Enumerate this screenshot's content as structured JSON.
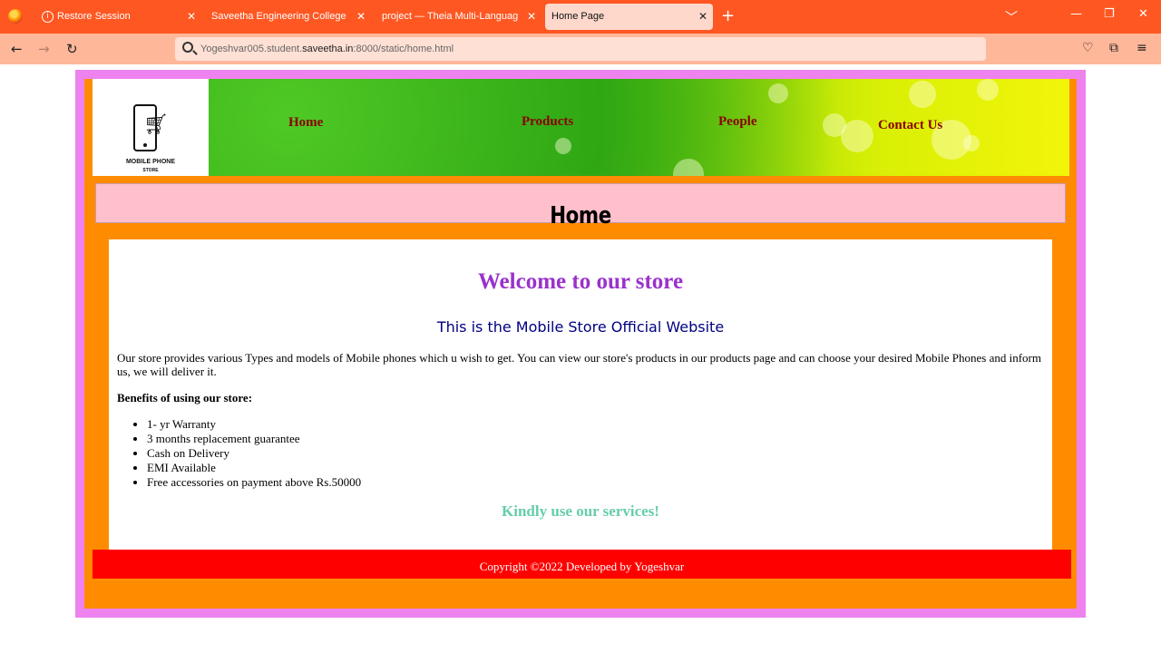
{
  "browser": {
    "tabs": [
      {
        "label": "Restore Session",
        "active": false
      },
      {
        "label": "Saveetha Engineering College",
        "active": false
      },
      {
        "label": "project — Theia Multi-Language Ex",
        "active": false
      },
      {
        "label": "Home Page",
        "active": true
      }
    ],
    "url_prefix": "Yogeshvar005.student.",
    "url_domain": "saveetha.in",
    "url_suffix": ":8000/static/home.html",
    "accent_color": "#ff5722"
  },
  "site": {
    "logo_line1": "MOBILE PHONE",
    "logo_line2": "STORE",
    "nav": [
      {
        "label": "Home"
      },
      {
        "label": "Products"
      },
      {
        "label": "People"
      },
      {
        "label": "Contact Us"
      }
    ],
    "page_title": "Home"
  },
  "content": {
    "welcome": "Welcome to our store",
    "subtitle": "This is the Mobile Store Official Website",
    "intro": "Our store provides various Types and models of Mobile phones which u wish to get. You can view our store's products in our products page and can choose your desired Mobile Phones and inform us, we will deliver it.",
    "benefits_heading": "Benefits of using our store:",
    "benefits": [
      "1- yr Warranty",
      "3 months replacement guarantee",
      "Cash on Delivery",
      "EMI Available",
      "Free accessories on payment above Rs.50000"
    ],
    "closing": "Kindly use our services!"
  },
  "footer": {
    "text": "Copyright ©2022 Developed by Yogeshvar"
  },
  "colors": {
    "frame": "#ee82ee",
    "inner": "#ff8c00",
    "title_band": "#ffc0cb",
    "footer": "#ff0000",
    "welcome": "#9932cc",
    "subtitle": "#000080",
    "closing": "#66cdaa",
    "nav_link": "#8b0000"
  }
}
